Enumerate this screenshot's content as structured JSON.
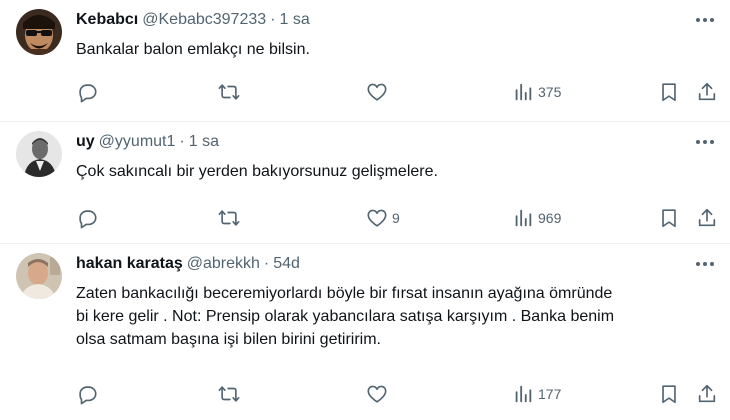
{
  "tweets": [
    {
      "name": "Kebabcı",
      "handle": "@Kebabc397233",
      "time": "1 sa",
      "text": "Bankalar balon emlakçı ne bilsin.",
      "replies": "",
      "retweets": "",
      "likes": "",
      "views": "375"
    },
    {
      "name": "uy",
      "handle": "@yyumut1",
      "time": "1 sa",
      "text": "Çok sakıncalı bir yerden bakıyorsunuz gelişmelere.",
      "replies": "",
      "retweets": "",
      "likes": "9",
      "views": "969"
    },
    {
      "name": "hakan karataş",
      "handle": "@abrekkh",
      "time": "54d",
      "text": "Zaten bankacılığı beceremiyorlardı böyle bir fırsat insanın ayağına ömründe\nbi kere gelir . Not: Prensip olarak yabancılara satışa karşıyım .  Banka benim\nolsa satmam başına işi bilen birini getiririm.",
      "replies": "",
      "retweets": "",
      "likes": "",
      "views": "177"
    }
  ],
  "separator": "·",
  "icons": {
    "reply": "reply-icon",
    "retweet": "retweet-icon",
    "like": "heart-icon",
    "views": "views-chart-icon",
    "bookmark": "bookmark-icon",
    "share": "share-icon",
    "more": "more-dots-icon"
  },
  "colors": {
    "text": "#0f1419",
    "secondary": "#536471",
    "divider": "#eff3f4"
  }
}
